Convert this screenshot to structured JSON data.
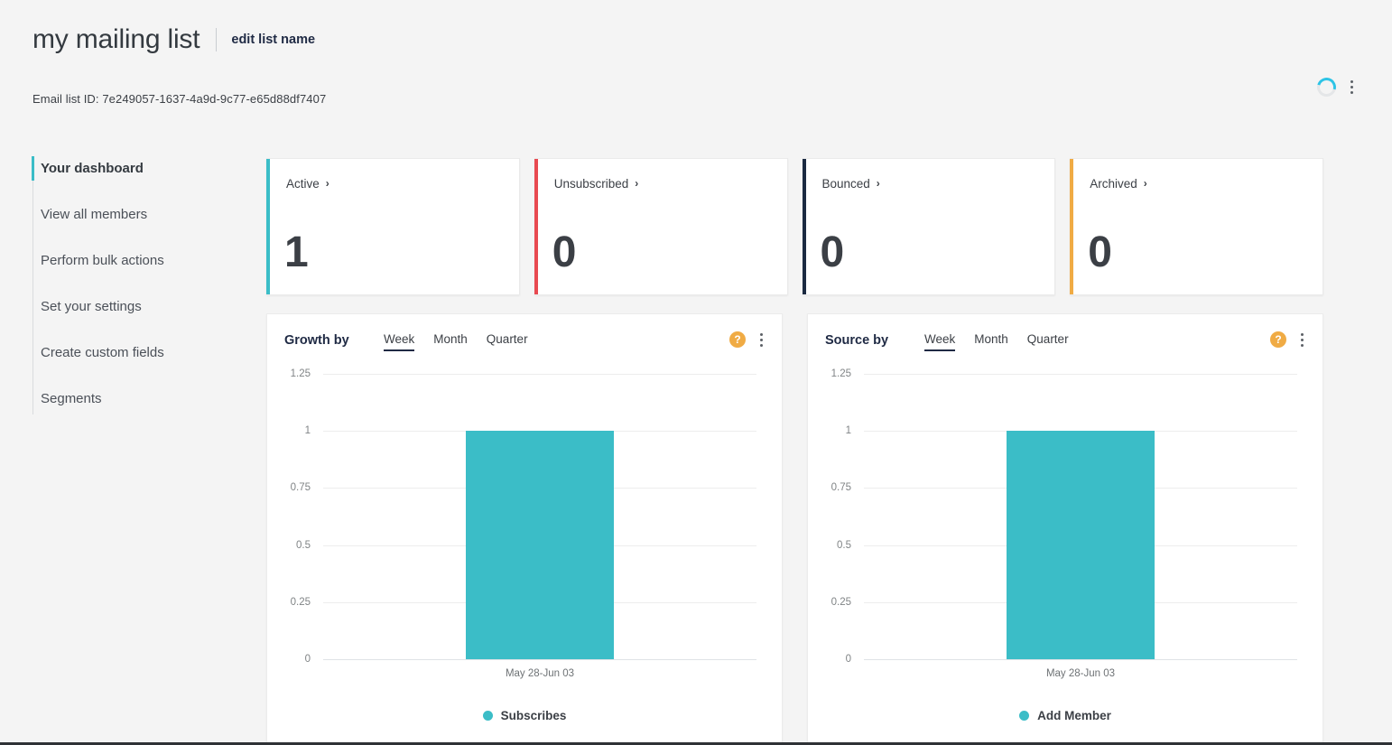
{
  "header": {
    "title": "my mailing list",
    "edit_label": "edit list name",
    "list_id": "Email list ID: 7e249057-1637-4a9d-9c77-e65d88df7407",
    "spinner_name": "loading-spinner",
    "menu_icon": "kebab-menu-icon"
  },
  "sidebar": {
    "items": [
      {
        "label": "Your dashboard",
        "active": true
      },
      {
        "label": "View all members",
        "active": false
      },
      {
        "label": "Perform bulk actions",
        "active": false
      },
      {
        "label": "Set your settings",
        "active": false
      },
      {
        "label": "Create custom fields",
        "active": false
      },
      {
        "label": "Segments",
        "active": false
      }
    ]
  },
  "cards": [
    {
      "label": "Active",
      "value": "1",
      "color": "#3bbdc7",
      "chevron": "›"
    },
    {
      "label": "Unsubscribed",
      "value": "0",
      "color": "#e84a51",
      "chevron": "›"
    },
    {
      "label": "Bounced",
      "value": "0",
      "color": "#1b2a41",
      "chevron": "›"
    },
    {
      "label": "Archived",
      "value": "0",
      "color": "#f0ab44",
      "chevron": "›"
    }
  ],
  "panels": [
    {
      "title": "Growth by",
      "tabs": [
        {
          "label": "Week",
          "active": true
        },
        {
          "label": "Month",
          "active": false
        },
        {
          "label": "Quarter",
          "active": false
        }
      ],
      "help_glyph": "?",
      "legend_label": "Subscribes"
    },
    {
      "title": "Source by",
      "tabs": [
        {
          "label": "Week",
          "active": true
        },
        {
          "label": "Month",
          "active": false
        },
        {
          "label": "Quarter",
          "active": false
        }
      ],
      "help_glyph": "?",
      "legend_label": "Add Member"
    }
  ],
  "chart_data": [
    {
      "type": "bar",
      "title": "Growth by",
      "categories": [
        "May 28-Jun 03"
      ],
      "series": [
        {
          "name": "Subscribes",
          "values": [
            1
          ],
          "color": "#3bbdc7"
        }
      ],
      "values": [
        1
      ],
      "yticks": [
        0,
        0.25,
        0.5,
        0.75,
        1,
        1.25
      ],
      "ytick_labels": [
        "0",
        "0.25",
        "0.5",
        "0.75",
        "1",
        "1.25"
      ],
      "ylim": [
        0,
        1.25
      ],
      "xlabel": "",
      "ylabel": "",
      "grid": true,
      "legend": "bottom",
      "legend_entries": [
        "Subscribes"
      ]
    },
    {
      "type": "bar",
      "title": "Source by",
      "categories": [
        "May 28-Jun 03"
      ],
      "series": [
        {
          "name": "Add Member",
          "values": [
            1
          ],
          "color": "#3bbdc7"
        }
      ],
      "values": [
        1
      ],
      "yticks": [
        0,
        0.25,
        0.5,
        0.75,
        1,
        1.25
      ],
      "ytick_labels": [
        "0",
        "0.25",
        "0.5",
        "0.75",
        "1",
        "1.25"
      ],
      "ylim": [
        0,
        1.25
      ],
      "xlabel": "",
      "ylabel": "",
      "grid": true,
      "legend": "bottom",
      "legend_entries": [
        "Add Member"
      ]
    }
  ]
}
